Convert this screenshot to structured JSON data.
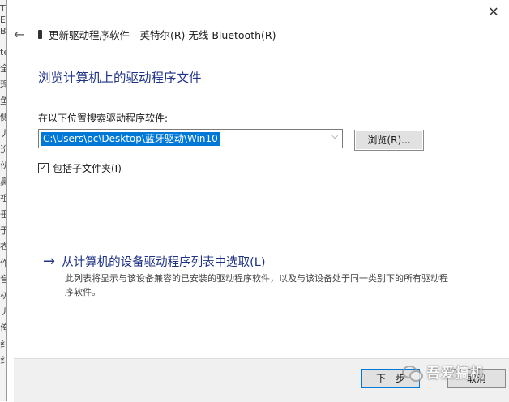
{
  "background_window": {
    "glyphs": [
      "T",
      "E",
      "B",
      "te",
      "全",
      "理",
      "鱼",
      "侧",
      "丿",
      "沇",
      "伙",
      "鼻",
      "祖",
      "垂",
      "于",
      "衣",
      "作",
      "音",
      "枋",
      "丿",
      "侉",
      "纟",
      "纟"
    ]
  },
  "dialog": {
    "title": "更新驱动程序软件 - 英特尔(R) 无线 Bluetooth(R)",
    "close_glyph": "✕",
    "back_glyph": "←",
    "heading": "浏览计算机上的驱动程序文件",
    "search_label": "在以下位置搜索驱动程序软件:",
    "path_value": "C:\\Users\\pc\\Desktop\\蓝牙驱动\\Win10",
    "browse_label": "浏览(R)...",
    "include_subfolders": {
      "label": "包括子文件夹(I)",
      "checked": true,
      "mark": "✓"
    },
    "pick_link": {
      "arrow": "→",
      "label": "从计算机的设备驱动程序列表中选取(L)",
      "description": "此列表将显示与该设备兼容的已安装的驱动程序软件，以及与该设备处于同一类别下的所有驱动程序软件。"
    },
    "footer": {
      "next_label": "下一步",
      "cancel_label": "取消"
    }
  },
  "watermark": {
    "text": "吾爱搞机"
  },
  "colors": {
    "accent": "#0078d7",
    "heading": "#1e3287",
    "footer_bg": "#f0f0f0"
  }
}
